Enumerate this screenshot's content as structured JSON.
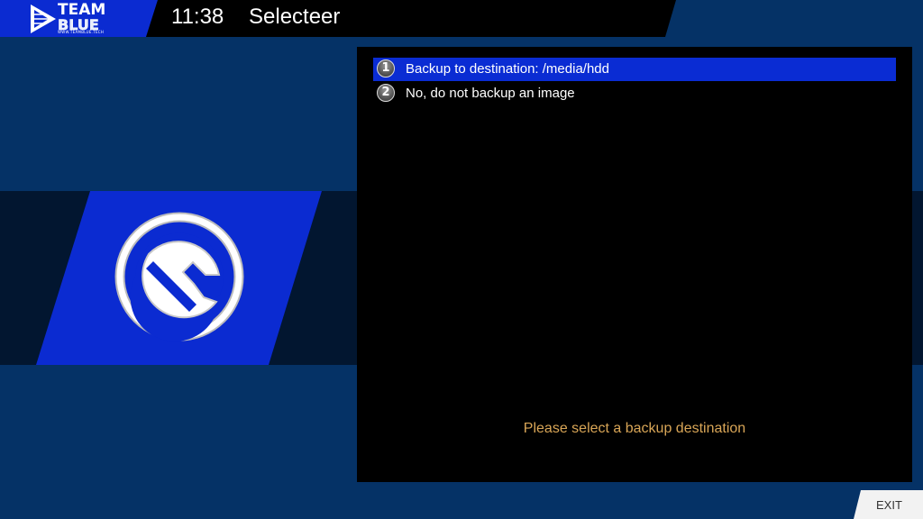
{
  "header": {
    "logo_line1": "TEAM",
    "logo_line2": "BLUE",
    "logo_sub": "WWW.TEAMBLUE.TECH",
    "clock": "11:38",
    "title": "Selecteer"
  },
  "menu": {
    "items": [
      {
        "number": "1",
        "label": "Backup to destination: /media/hdd",
        "selected": true
      },
      {
        "number": "2",
        "label": "No, do not backup an image",
        "selected": false
      }
    ]
  },
  "hint": "Please select a backup destination",
  "footer": {
    "exit_label": "EXIT"
  },
  "icons": {
    "main": "wrench-icon"
  },
  "colors": {
    "background": "#053266",
    "band": "#021630",
    "accent": "#0a2cd3",
    "hint": "#d9a657"
  }
}
